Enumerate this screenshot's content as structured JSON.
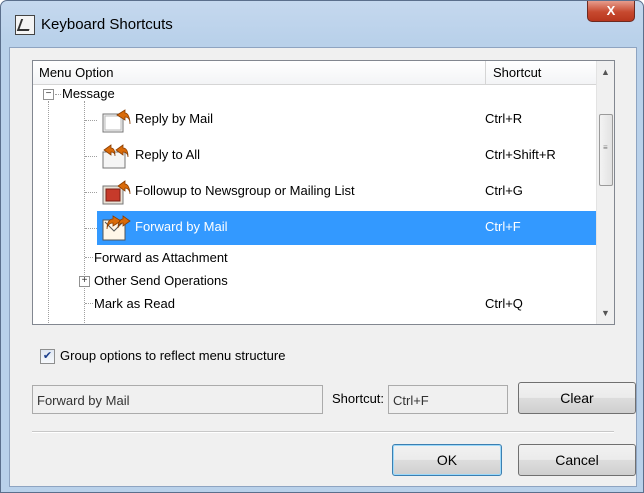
{
  "window": {
    "title": "Keyboard Shortcuts",
    "close_label": "X"
  },
  "list": {
    "columns": {
      "menu": "Menu Option",
      "shortcut": "Shortcut"
    },
    "group": {
      "label": "Message",
      "expander": "−"
    },
    "items": [
      {
        "label": "Reply by Mail",
        "shortcut": "Ctrl+R",
        "icon": "reply-mail-icon"
      },
      {
        "label": "Reply to All",
        "shortcut": "Ctrl+Shift+R",
        "icon": "reply-all-icon"
      },
      {
        "label": "Followup to Newsgroup or Mailing List",
        "shortcut": "Ctrl+G",
        "icon": "followup-icon"
      },
      {
        "label": "Forward by Mail",
        "shortcut": "Ctrl+F",
        "icon": "forward-mail-icon",
        "selected": true
      },
      {
        "label": "Forward as Attachment",
        "shortcut": ""
      },
      {
        "label": "Other Send Operations",
        "shortcut": "",
        "expander": "+"
      },
      {
        "label": "Mark as Read",
        "shortcut": "Ctrl+Q"
      }
    ]
  },
  "options": {
    "group_checkbox_label": "Group options to reflect menu structure",
    "group_checked": true
  },
  "editor": {
    "name_value": "Forward by Mail",
    "shortcut_label": "Shortcut:",
    "shortcut_value": "Ctrl+F",
    "clear_label": "Clear"
  },
  "buttons": {
    "ok": "OK",
    "cancel": "Cancel"
  },
  "colors": {
    "selection": "#3399ff",
    "close": "#c7492f"
  }
}
